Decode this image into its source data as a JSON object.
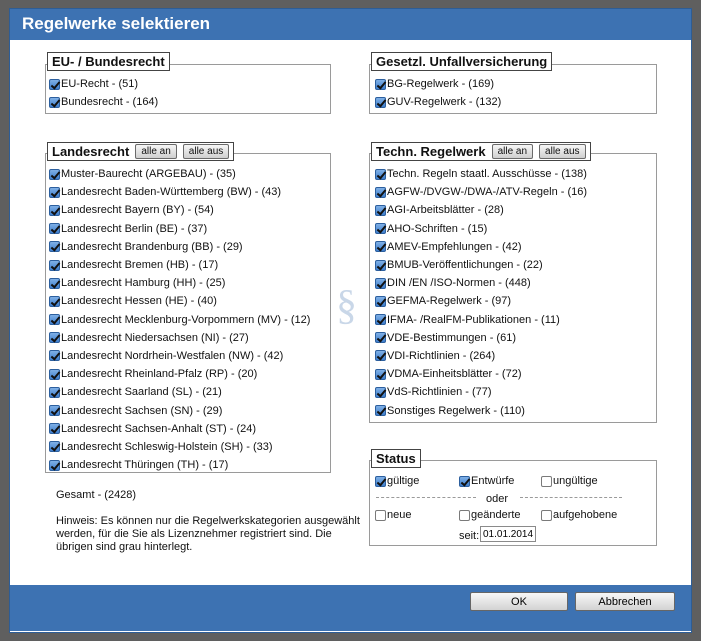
{
  "dialog": {
    "title": "Regelwerke selektieren"
  },
  "eu_group": {
    "legend": "EU- / Bundesrecht",
    "items": [
      {
        "label": "EU-Recht - (51)",
        "checked": true
      },
      {
        "label": "Bundesrecht - (164)",
        "checked": true
      }
    ]
  },
  "guv_group": {
    "legend": "Gesetzl. Unfallversicherung",
    "items": [
      {
        "label": "BG-Regelwerk - (169)",
        "checked": true
      },
      {
        "label": "GUV-Regelwerk - (132)",
        "checked": true
      }
    ]
  },
  "land_group": {
    "legend": "Landesrecht",
    "all_on": "alle an",
    "all_off": "alle aus",
    "items": [
      {
        "label": "Muster-Baurecht (ARGEBAU) - (35)",
        "checked": true
      },
      {
        "label": "Landesrecht Baden-Württemberg (BW) - (43)",
        "checked": true
      },
      {
        "label": "Landesrecht Bayern (BY) - (54)",
        "checked": true
      },
      {
        "label": "Landesrecht Berlin (BE) - (37)",
        "checked": true
      },
      {
        "label": "Landesrecht Brandenburg (BB) - (29)",
        "checked": true
      },
      {
        "label": "Landesrecht Bremen (HB) - (17)",
        "checked": true
      },
      {
        "label": "Landesrecht Hamburg (HH) - (25)",
        "checked": true
      },
      {
        "label": "Landesrecht Hessen (HE) - (40)",
        "checked": true
      },
      {
        "label": "Landesrecht Mecklenburg-Vorpommern (MV) - (12)",
        "checked": true
      },
      {
        "label": "Landesrecht Niedersachsen (NI) - (27)",
        "checked": true
      },
      {
        "label": "Landesrecht Nordrhein-Westfalen (NW) - (42)",
        "checked": true
      },
      {
        "label": "Landesrecht Rheinland-Pfalz (RP) - (20)",
        "checked": true
      },
      {
        "label": "Landesrecht Saarland (SL) - (21)",
        "checked": true
      },
      {
        "label": "Landesrecht Sachsen (SN) - (29)",
        "checked": true
      },
      {
        "label": "Landesrecht Sachsen-Anhalt (ST) - (24)",
        "checked": true
      },
      {
        "label": "Landesrecht Schleswig-Holstein (SH) - (33)",
        "checked": true
      },
      {
        "label": "Landesrecht Thüringen (TH) - (17)",
        "checked": true
      }
    ]
  },
  "tech_group": {
    "legend": "Techn. Regelwerk",
    "all_on": "alle an",
    "all_off": "alle aus",
    "items": [
      {
        "label": "Techn. Regeln staatl. Ausschüsse - (138)",
        "checked": true
      },
      {
        "label": "AGFW-/DVGW-/DWA-/ATV-Regeln - (16)",
        "checked": true
      },
      {
        "label": "AGI-Arbeitsblätter - (28)",
        "checked": true
      },
      {
        "label": "AHO-Schriften - (15)",
        "checked": true
      },
      {
        "label": "AMEV-Empfehlungen - (42)",
        "checked": true
      },
      {
        "label": "BMUB-Veröffentlichungen - (22)",
        "checked": true
      },
      {
        "label": "DIN /EN /ISO-Normen - (448)",
        "checked": true
      },
      {
        "label": "GEFMA-Regelwerk - (97)",
        "checked": true
      },
      {
        "label": "IFMA- /RealFM-Publikationen - (11)",
        "checked": true
      },
      {
        "label": "VDE-Bestimmungen - (61)",
        "checked": true
      },
      {
        "label": "VDI-Richtlinien - (264)",
        "checked": true
      },
      {
        "label": "VDMA-Einheitsblätter - (72)",
        "checked": true
      },
      {
        "label": "VdS-Richtlinien - (77)",
        "checked": true
      },
      {
        "label": "Sonstiges Regelwerk - (110)",
        "checked": true
      }
    ]
  },
  "status": {
    "legend": "Status",
    "valid": {
      "label": "gültige",
      "checked": true
    },
    "drafts": {
      "label": "Entwürfe",
      "checked": true
    },
    "invalid": {
      "label": "ungültige",
      "checked": false
    },
    "or": "oder",
    "new": {
      "label": "neue",
      "checked": false
    },
    "changed": {
      "label": "geänderte",
      "checked": false
    },
    "repealed": {
      "label": "aufgehobene",
      "checked": false
    },
    "since_label": "seit:",
    "since_value": "01.01.2014"
  },
  "total": "Gesamt - (2428)",
  "hint": "Hinweis: Es können nur die Regelwerkskategorien ausgewählt werden, für die Sie als Lizenznehmer registriert sind. Die übrigen sind grau hinterlegt.",
  "decor": {
    "section_sign": "§"
  },
  "buttons": {
    "ok": "OK",
    "cancel": "Abbrechen"
  },
  "colors": {
    "accent": "#3d72b2",
    "backdrop": "#5f5f5f"
  }
}
